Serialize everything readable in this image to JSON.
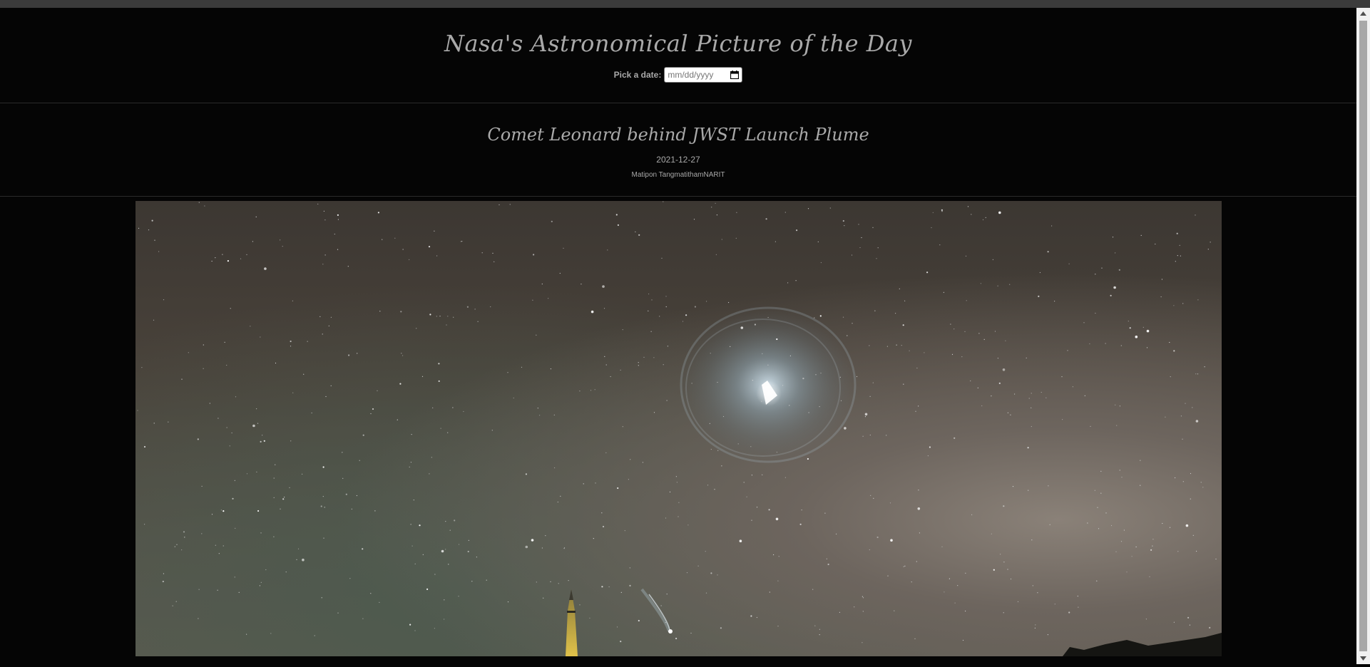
{
  "header": {
    "title": "Nasa's Astronomical Picture of the Day",
    "date_label": "Pick a date:",
    "date_placeholder": "mm/dd/yyyy",
    "date_icon": "calendar-icon"
  },
  "apod": {
    "title": "Comet Leonard behind JWST Launch Plume",
    "date": "2021-12-27",
    "copyright": "Matipon TangmatithamNARIT"
  },
  "colors": {
    "background": "#050505",
    "text": "#a9a9a9",
    "divider": "#2a2a2a"
  }
}
